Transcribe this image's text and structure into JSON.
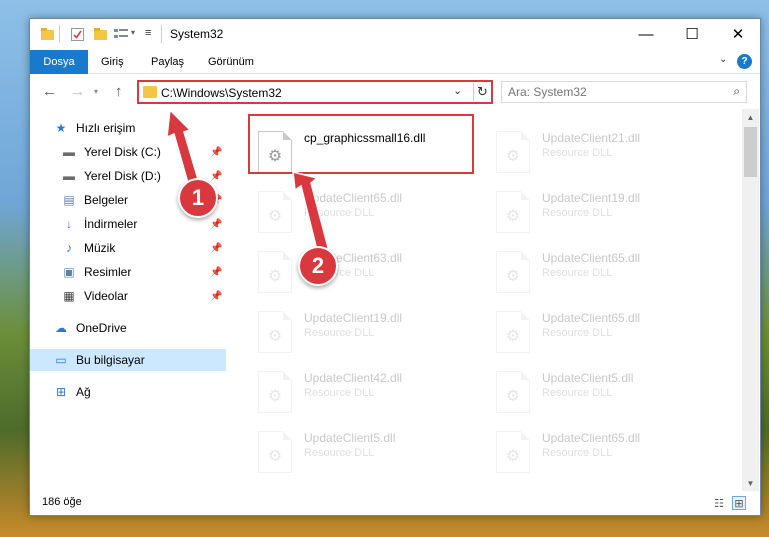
{
  "window": {
    "title": "System32",
    "caption": {
      "minimize": "—",
      "maximize": "☐",
      "close": "✕"
    }
  },
  "ribbon": {
    "tabs": [
      "Dosya",
      "Giriş",
      "Paylaş",
      "Görünüm"
    ],
    "help": "?"
  },
  "address": {
    "path": "C:\\Windows\\System32",
    "dropdown": "⌄",
    "refresh": "↻"
  },
  "search": {
    "placeholder": "Ara: System32",
    "icon": "⌕"
  },
  "sidebar": {
    "items": [
      {
        "label": "Hızlı erişim",
        "icon": "★",
        "icon_name": "star-icon",
        "pinned": false
      },
      {
        "label": "Yerel Disk (C:)",
        "icon": "▬",
        "icon_name": "drive-icon",
        "pinned": true
      },
      {
        "label": "Yerel Disk (D:)",
        "icon": "▬",
        "icon_name": "drive-icon",
        "pinned": true
      },
      {
        "label": "Belgeler",
        "icon": "▤",
        "icon_name": "document-icon",
        "pinned": true
      },
      {
        "label": "İndirmeler",
        "icon": "↓",
        "icon_name": "download-icon",
        "pinned": true
      },
      {
        "label": "Müzik",
        "icon": "♪",
        "icon_name": "music-icon",
        "pinned": true
      },
      {
        "label": "Resimler",
        "icon": "▣",
        "icon_name": "pictures-icon",
        "pinned": true
      },
      {
        "label": "Videolar",
        "icon": "▦",
        "icon_name": "video-icon",
        "pinned": true
      },
      {
        "label": "OneDrive",
        "icon": "☁",
        "icon_name": "cloud-icon",
        "pinned": false
      },
      {
        "label": "Bu bilgisayar",
        "icon": "▭",
        "icon_name": "computer-icon",
        "pinned": false
      },
      {
        "label": "Ağ",
        "icon": "⊞",
        "icon_name": "network-icon",
        "pinned": false
      }
    ],
    "pin_glyph": "📌"
  },
  "files": {
    "highlighted": {
      "name": "cp_graphicssmall16.dll",
      "type": ""
    },
    "left_column": [
      {
        "name": "UpdateClient65.dll",
        "type": "Resource DLL"
      },
      {
        "name": "UpdateClient63.dll",
        "type": "Resource DLL"
      },
      {
        "name": "UpdateClient19.dll",
        "type": "Resource DLL"
      },
      {
        "name": "UpdateClient42.dll",
        "type": "Resource DLL"
      },
      {
        "name": "UpdateClient5.dll",
        "type": "Resource DLL"
      }
    ],
    "right_column": [
      {
        "name": "UpdateClient21.dll",
        "type": "Resource DLL"
      },
      {
        "name": "UpdateClient19.dll",
        "type": "Resource DLL"
      },
      {
        "name": "UpdateClient65.dll",
        "type": "Resource DLL"
      },
      {
        "name": "UpdateClient65.dll",
        "type": "Resource DLL"
      },
      {
        "name": "UpdateClient5.dll",
        "type": "Resource DLL"
      },
      {
        "name": "UpdateClient65.dll",
        "type": "Resource DLL"
      }
    ],
    "icon_glyph": "⚙"
  },
  "status": {
    "count": "186 öğe"
  },
  "annotations": {
    "step1": "1",
    "step2": "2"
  },
  "colors": {
    "accent": "#1979ca",
    "highlight": "#d9393e",
    "selected": "#cce8ff"
  }
}
